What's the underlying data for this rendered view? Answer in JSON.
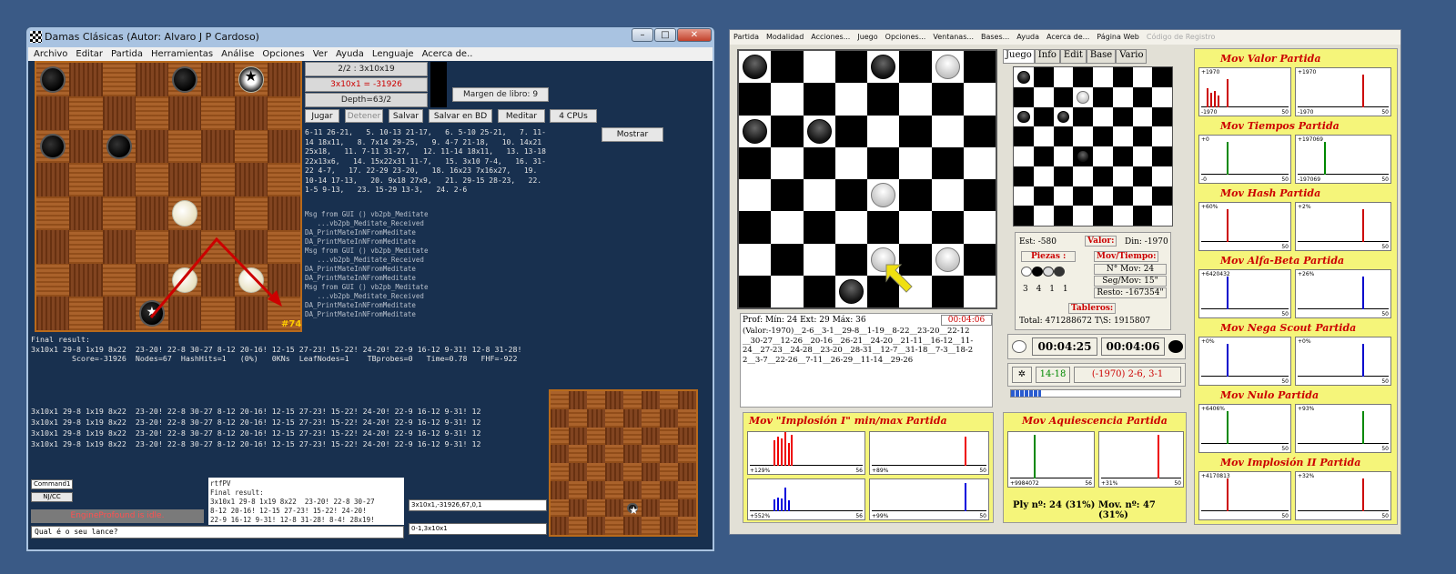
{
  "w1": {
    "title": "Damas Clásicas  (Autor: Alvaro J P Cardoso)",
    "menu": [
      "Archivo",
      "Editar",
      "Partida",
      "Herramientas",
      "Análise",
      "Opciones",
      "Ver",
      "Ayuda",
      "Lenguaje",
      "Acerca de.."
    ],
    "board_label": "#74",
    "info1": "2/2 : 3x10x19",
    "info2": "3x10x1 = -31926",
    "info3": "Depth=63/2",
    "book": "Margen de libro: 9",
    "buttons": [
      "Jugar",
      "Detener",
      "Salvar",
      "Salvar en BD",
      "Meditar",
      "4 CPUs"
    ],
    "mostrar": "Mostrar",
    "moves": "6-11 26-21,   5. 10-13 21-17,   6. 5-10 25-21,   7. 11-\n14 18x11,   8. 7x14 29-25,   9. 4-7 21-18,   10. 14x21\n25x18,   11. 7-11 31-27,   12. 11-14 18x11,   13. 13-18\n22x13x6,   14. 15x22x31 11-7,   15. 3x10 7-4,   16. 31-\n22 4-7,   17. 22-29 23-20,   18. 16x23 7x16x27,   19.\n10-14 17-13,   20. 9x18 27x9,   21. 29-15 28-23,   22.\n1-5 9-13,   23. 15-29 13-3,   24. 2-6",
    "log": "Msg from GUI () vb2pb_Meditate\n   ...vb2pb_Meditate_Received\nDA_PrintMateInNFromMeditate\nDA_PrintMateInNFromMeditate\nMsg from GUI () vb2pb_Meditate\n   ...vb2pb_Meditate_Received\nDA_PrintMateInNFromMeditate\nDA_PrintMateInNFromMeditate\nMsg from GUI () vb2pb_Meditate\n   ...vb2pb_Meditate_Received\nDA_PrintMateInNFromMeditate\nDA_PrintMateInNFromMeditate",
    "final": "Final result:\n3x10x1 29-8 1x19 8x22  23-20! 22-8 30-27 8-12 20-16! 12-15 27-23! 15-22! 24-20! 22-9 16-12 9-31! 12-8 31-28!\n         Score=-31926  Nodes=67  HashHits=1   (0%)   0KNs  LeafNodes=1    TBprobes=0   Time=0.78   FHF=-922",
    "lines": "3x10x1 29-8 1x19 8x22  23-20! 22-8 30-27 8-12 20-16! 12-15 27-23! 15-22! 24-20! 22-9 16-12 9-31! 12\n3x10x1 29-8 1x19 8x22  23-20! 22-8 30-27 8-12 20-16! 12-15 27-23! 15-22! 24-20! 22-9 16-12 9-31! 12\n3x10x1 29-8 1x19 8x22  23-20! 22-8 30-27 8-12 20-16! 12-15 27-23! 15-22! 24-20! 22-9 16-12 9-31! 12\n3x10x1 29-8 1x19 8x22  23-20! 22-8 30-27 8-12 20-16! 12-15 27-23! 15-22! 24-20! 22-9 16-12 9-31! 12",
    "command": "Command1",
    "njcc": "NJ/CC",
    "status": "EngineProfound is idle.",
    "rtf": "rtfPV\nFinal result:\n3x10x1 29-8 1x19 8x22  23-20! 22-8 30-27\n8-12 20-16! 12-15 27-23! 15-22! 24-20!\n22-9 16-12 9-31! 12-8 31-28! 8-4! 28x19!",
    "pv1": "3x10x1,-31926,67,0,1",
    "pv2": "0-1,3x10x1",
    "prompt": "Qual é o seu lance?"
  },
  "w2": {
    "menu": [
      "Partida",
      "Modalidad",
      "Acciones...",
      "Juego",
      "Opciones...",
      "Ventanas...",
      "Bases...",
      "Ayuda",
      "Acerca de...",
      "Página Web",
      "Código de Registro"
    ],
    "tabs": [
      "Juego",
      "Info",
      "Edit",
      "Base",
      "Vario"
    ],
    "prof": "Prof: Mín: 24  Ext: 29   Máx: 36",
    "clock_red": "00:04:06",
    "notation": "(Valor:-1970)__2-6__3-1__29-8__1-19__8-22__23-20__22-12\n__30-27__12-26__20-16__26-21__24-20__21-11__16-12__11-\n24__27-23__24-28__23-20__28-31__12-7__31-18__7-3__18-2\n2__3-7__22-26__7-11__26-29__11-14__29-26",
    "est": "Est: -580",
    "valor": "Valor:",
    "din": "Din: -1970",
    "piezas": "Piezas :",
    "counts": [
      "3",
      "4",
      "1",
      "1"
    ],
    "movtiempo": "Mov/Tiempo:",
    "nmov": "N° Mov: 24",
    "segmov": "Seg/Mov: 15\"",
    "resto": "Resto: -167354\"",
    "tableros": "Tableros:",
    "total": "Total: 471288672  T\\S: 1915807",
    "clock1": "00:04:25",
    "clock2": "00:04:06",
    "move_range": "14-18",
    "best": "(-1970) 2-6, 3-1",
    "ply": "Ply nº: 24 (31%)",
    "movn": "Mov. nº: 47 (31%)",
    "graphs": {
      "valor": {
        "title": "Mov       Valor      Partida",
        "l1": "+1970",
        "l2": "-1970",
        "r1": "+1970",
        "r2": "-1970",
        "n": "50"
      },
      "tiempos": {
        "title": "Mov    Tiempos    Partida",
        "l1": "+0",
        "l2": "-0",
        "r1": "+197069",
        "r2": "-197069",
        "n": "50"
      },
      "hash": {
        "title": "Mov        Hash        Partida",
        "l1": "+60%",
        "r1": "+2%",
        "n": "50"
      },
      "alfa": {
        "title": "Mov    Alfa-Beta    Partida",
        "l1": "+6420432",
        "r1": "+26%",
        "n": "50"
      },
      "nega": {
        "title": "Mov   Nega Scout  Partida",
        "l1": "+0%",
        "r1": "+0%",
        "n": "50"
      },
      "nulo": {
        "title": "Mov        Nulo        Partida",
        "l1": "+6406%",
        "r1": "+93%",
        "n": "50"
      },
      "imp2": {
        "title": "Mov  Implosión II  Partida",
        "l1": "+4170813",
        "r1": "+32%",
        "n": "50"
      },
      "imp1": {
        "title": "Mov      \"Implosión I\" min/max    Partida",
        "a": "+129%",
        "b": "+89%",
        "c": "+552%",
        "d": "+99%",
        "n1": "56",
        "n2": "50"
      },
      "aqui": {
        "title": "Mov     Aquiescencia     Partida",
        "a": "+9984072",
        "b": "+31%",
        "n1": "56",
        "n2": "50"
      }
    }
  },
  "colors": {
    "desktop": "#3a5a86",
    "console": "#18304f",
    "accent_red": "#cc0000",
    "graph_yellow": "#f5f57a"
  }
}
